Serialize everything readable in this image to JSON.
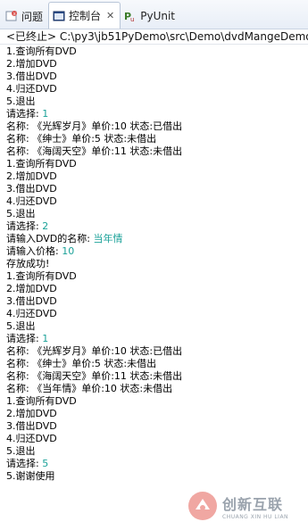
{
  "tabs": [
    {
      "label": "问题",
      "icon": "problems-icon"
    },
    {
      "label": "控制台",
      "icon": "console-icon",
      "active": true
    },
    {
      "label": "PyUnit",
      "icon": "pyunit-icon"
    }
  ],
  "path": "<已终止> C:\\py3\\jb51PyDemo\\src\\Demo\\dvdMangeDemo",
  "console_lines": [
    {
      "text": "1.查询所有DVD"
    },
    {
      "text": "2.增加DVD"
    },
    {
      "text": "3.借出DVD"
    },
    {
      "text": "4.归还DVD"
    },
    {
      "text": "5.退出"
    },
    {
      "text": "请选择: ",
      "input": "1"
    },
    {
      "text": "名称: 《光辉岁月》单价:10 状态:已借出"
    },
    {
      "text": "名称: 《绅士》单价:5 状态:未借出"
    },
    {
      "text": "名称: 《海阔天空》单价:11 状态:未借出"
    },
    {
      "text": "1.查询所有DVD"
    },
    {
      "text": "2.增加DVD"
    },
    {
      "text": "3.借出DVD"
    },
    {
      "text": "4.归还DVD"
    },
    {
      "text": "5.退出"
    },
    {
      "text": "请选择: ",
      "input": "2"
    },
    {
      "text": "请输入DVD的名称: ",
      "input": "当年情"
    },
    {
      "text": "请输入价格: ",
      "input": "10"
    },
    {
      "text": "存放成功!"
    },
    {
      "text": "1.查询所有DVD"
    },
    {
      "text": "2.增加DVD"
    },
    {
      "text": "3.借出DVD"
    },
    {
      "text": "4.归还DVD"
    },
    {
      "text": "5.退出"
    },
    {
      "text": "请选择: ",
      "input": "1"
    },
    {
      "text": "名称: 《光辉岁月》单价:10 状态:已借出"
    },
    {
      "text": "名称: 《绅士》单价:5 状态:未借出"
    },
    {
      "text": "名称: 《海阔天空》单价:11 状态:未借出"
    },
    {
      "text": "名称: 《当年情》单价:10 状态:未借出"
    },
    {
      "text": "1.查询所有DVD"
    },
    {
      "text": "2.增加DVD"
    },
    {
      "text": "3.借出DVD"
    },
    {
      "text": "4.归还DVD"
    },
    {
      "text": "5.退出"
    },
    {
      "text": "请选择: ",
      "input": "5"
    },
    {
      "text": "5.谢谢使用"
    }
  ],
  "colors": {
    "input": "#1aa198",
    "output": "#000000"
  },
  "watermark": {
    "cn": "创新互联",
    "en": "CHUANG XIN HU LIAN"
  }
}
